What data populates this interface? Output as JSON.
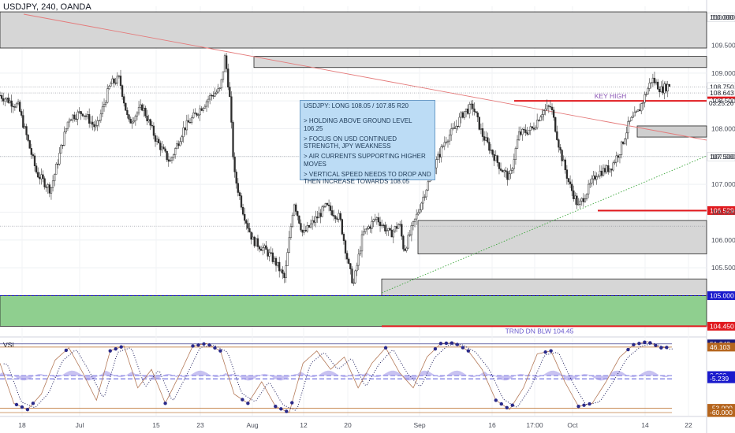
{
  "header": {
    "symbol_line": "USDJPY, 240, OANDA"
  },
  "note": {
    "lines": [
      "USDJPY: LONG 108.05 / 107.85 R20",
      "> HOLDING ABOVE GROUND LEVEL 106.25",
      "> FOCUS ON USD CONTINUED STRENGTH, JPY WEAKNESS",
      "> AIR CURRENTS SUPPORTING HIGHER MOVES",
      "> VERTICAL SPEED NEEDS TO DROP AND THEN INCREASE TOWARDS 108.05"
    ]
  },
  "chart_data": [
    {
      "type": "candlestick",
      "symbol": "USDJPY",
      "timeframe": "240",
      "source": "OANDA",
      "x_tick_labels": [
        "18",
        "Jul",
        "15",
        "23",
        "Aug",
        "12",
        "20",
        "Sep",
        "16",
        "17:00",
        "Oct",
        "14",
        "22"
      ],
      "y_tick_labels": [
        110.0,
        109.5,
        109.0,
        108.5,
        108.0,
        107.5,
        107.0,
        106.5,
        106.0,
        105.5
      ],
      "ylim": [
        104.3,
        110.2
      ],
      "grid": true,
      "price_path": [
        {
          "d": 0,
          "p": 108.6
        },
        {
          "d": 4,
          "p": 108.4
        },
        {
          "d": 8,
          "p": 107.2
        },
        {
          "d": 11,
          "p": 106.9
        },
        {
          "d": 15,
          "p": 108.2
        },
        {
          "d": 18,
          "p": 108.3
        },
        {
          "d": 21,
          "p": 108.0
        },
        {
          "d": 24,
          "p": 108.8
        },
        {
          "d": 26,
          "p": 108.9
        },
        {
          "d": 28,
          "p": 108.1
        },
        {
          "d": 31,
          "p": 108.4
        },
        {
          "d": 34,
          "p": 107.8
        },
        {
          "d": 37,
          "p": 107.4
        },
        {
          "d": 40,
          "p": 108.0
        },
        {
          "d": 43,
          "p": 108.3
        },
        {
          "d": 46,
          "p": 108.6
        },
        {
          "d": 48,
          "p": 108.7
        },
        {
          "d": 49,
          "p": 109.3
        },
        {
          "d": 50,
          "p": 108.6
        },
        {
          "d": 51,
          "p": 107.2
        },
        {
          "d": 53,
          "p": 106.5
        },
        {
          "d": 55,
          "p": 106.0
        },
        {
          "d": 58,
          "p": 105.8
        },
        {
          "d": 60,
          "p": 105.6
        },
        {
          "d": 62,
          "p": 105.3
        },
        {
          "d": 64,
          "p": 106.7
        },
        {
          "d": 66,
          "p": 106.1
        },
        {
          "d": 69,
          "p": 106.4
        },
        {
          "d": 71,
          "p": 106.6
        },
        {
          "d": 74,
          "p": 106.4
        },
        {
          "d": 76,
          "p": 105.5
        },
        {
          "d": 77,
          "p": 105.2
        },
        {
          "d": 79,
          "p": 106.1
        },
        {
          "d": 82,
          "p": 106.4
        },
        {
          "d": 85,
          "p": 106.1
        },
        {
          "d": 87,
          "p": 106.3
        },
        {
          "d": 88,
          "p": 105.8
        },
        {
          "d": 91,
          "p": 106.5
        },
        {
          "d": 94,
          "p": 107.2
        },
        {
          "d": 97,
          "p": 107.8
        },
        {
          "d": 99,
          "p": 108.0
        },
        {
          "d": 101,
          "p": 108.3
        },
        {
          "d": 103,
          "p": 108.4
        },
        {
          "d": 105,
          "p": 107.9
        },
        {
          "d": 107,
          "p": 107.6
        },
        {
          "d": 109,
          "p": 107.3
        },
        {
          "d": 111,
          "p": 107.1
        },
        {
          "d": 113,
          "p": 107.9
        },
        {
          "d": 116,
          "p": 108.0
        },
        {
          "d": 118,
          "p": 108.3
        },
        {
          "d": 120,
          "p": 108.4
        },
        {
          "d": 122,
          "p": 107.6
        },
        {
          "d": 124,
          "p": 107.0
        },
        {
          "d": 126,
          "p": 106.6
        },
        {
          "d": 128,
          "p": 106.9
        },
        {
          "d": 130,
          "p": 107.2
        },
        {
          "d": 133,
          "p": 107.3
        },
        {
          "d": 135,
          "p": 107.6
        },
        {
          "d": 137,
          "p": 108.1
        },
        {
          "d": 139,
          "p": 108.3
        },
        {
          "d": 141,
          "p": 108.7
        },
        {
          "d": 142,
          "p": 108.9
        },
        {
          "d": 144,
          "p": 108.7
        },
        {
          "d": 146,
          "p": 108.8
        }
      ],
      "horizontal_levels": [
        {
          "price": 110.0,
          "label": "110.000"
        },
        {
          "price": 108.75,
          "label": "108.750"
        },
        {
          "price": 108.643,
          "label": "108.643"
        },
        {
          "price": 108.5,
          "label": "108.500",
          "color": "#e0191e"
        },
        {
          "price": 107.5,
          "label": "107.500"
        },
        {
          "price": 106.529,
          "label": "106.529",
          "color": "#e0191e"
        },
        {
          "price": 105.0,
          "label": "105.000",
          "color": "#1a1acc"
        },
        {
          "price": 104.45,
          "label": "104.450",
          "color": "#e0191e"
        }
      ],
      "timer_label": "03:25:26",
      "annotations": [
        {
          "text": "KEY HIGH",
          "price": 108.5
        },
        {
          "text": "TRND DN BLW 104.45",
          "price": 104.45
        }
      ],
      "zones": [
        {
          "from": 109.45,
          "to": 110.1,
          "color": "#d6d6d6"
        },
        {
          "from": 105.0,
          "to": 104.45,
          "color": "#8fcf8f"
        }
      ]
    },
    {
      "type": "line",
      "title": "VSI",
      "y_tick_labels": [
        51.342,
        46.103,
        0.0,
        -5.239,
        -53.0,
        -60.0
      ],
      "ylim": [
        -65,
        60
      ],
      "levels": [
        {
          "value": 51.342,
          "label": "51.342",
          "color": "#1a1a7a"
        },
        {
          "value": 46.103,
          "label": "46.103",
          "color": "#b5651d"
        },
        {
          "value": 0.0,
          "label": "0.000",
          "color": "#1a1acc"
        },
        {
          "value": -5.239,
          "label": "-5.239",
          "color": "#1a1acc"
        },
        {
          "value": -53.0,
          "label": "-53.000",
          "color": "#b5651d"
        },
        {
          "value": -60.0,
          "label": "-60.000",
          "color": "#b5651d"
        }
      ],
      "oscillator_path": [
        {
          "d": 0,
          "v": 20
        },
        {
          "d": 3,
          "v": -45
        },
        {
          "d": 6,
          "v": -55
        },
        {
          "d": 9,
          "v": -30
        },
        {
          "d": 12,
          "v": 25
        },
        {
          "d": 15,
          "v": 45
        },
        {
          "d": 18,
          "v": 5
        },
        {
          "d": 21,
          "v": -40
        },
        {
          "d": 24,
          "v": 40
        },
        {
          "d": 27,
          "v": 48
        },
        {
          "d": 30,
          "v": -20
        },
        {
          "d": 33,
          "v": 10
        },
        {
          "d": 36,
          "v": -45
        },
        {
          "d": 39,
          "v": 0
        },
        {
          "d": 42,
          "v": 48
        },
        {
          "d": 45,
          "v": 52
        },
        {
          "d": 48,
          "v": 40
        },
        {
          "d": 51,
          "v": -30
        },
        {
          "d": 54,
          "v": -45
        },
        {
          "d": 57,
          "v": -10
        },
        {
          "d": 60,
          "v": -50
        },
        {
          "d": 63,
          "v": -60
        },
        {
          "d": 66,
          "v": 20
        },
        {
          "d": 69,
          "v": 40
        },
        {
          "d": 72,
          "v": 10
        },
        {
          "d": 75,
          "v": 30
        },
        {
          "d": 78,
          "v": -20
        },
        {
          "d": 81,
          "v": 20
        },
        {
          "d": 84,
          "v": 45
        },
        {
          "d": 87,
          "v": 5
        },
        {
          "d": 90,
          "v": -20
        },
        {
          "d": 93,
          "v": 30
        },
        {
          "d": 96,
          "v": 52
        },
        {
          "d": 99,
          "v": 53
        },
        {
          "d": 102,
          "v": 40
        },
        {
          "d": 105,
          "v": 10
        },
        {
          "d": 108,
          "v": -40
        },
        {
          "d": 111,
          "v": -55
        },
        {
          "d": 114,
          "v": -20
        },
        {
          "d": 117,
          "v": 35
        },
        {
          "d": 120,
          "v": 40
        },
        {
          "d": 123,
          "v": -10
        },
        {
          "d": 126,
          "v": -50
        },
        {
          "d": 129,
          "v": -45
        },
        {
          "d": 132,
          "v": -10
        },
        {
          "d": 135,
          "v": 30
        },
        {
          "d": 138,
          "v": 50
        },
        {
          "d": 141,
          "v": 55
        },
        {
          "d": 144,
          "v": 45
        },
        {
          "d": 146,
          "v": 46
        }
      ]
    }
  ]
}
